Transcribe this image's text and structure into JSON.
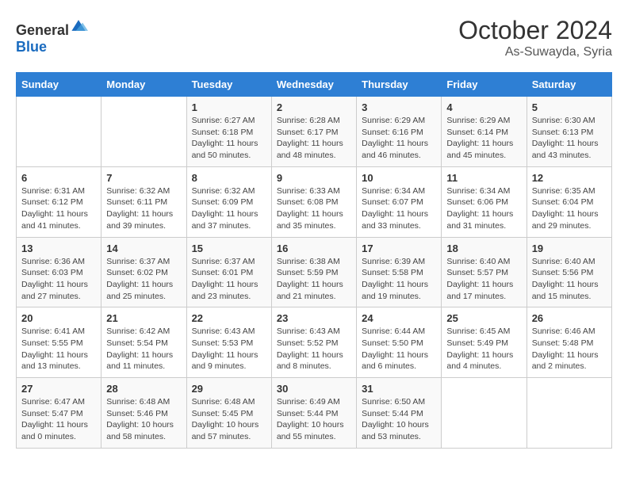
{
  "header": {
    "logo_general": "General",
    "logo_blue": "Blue",
    "month": "October 2024",
    "location": "As-Suwayda, Syria"
  },
  "days_of_week": [
    "Sunday",
    "Monday",
    "Tuesday",
    "Wednesday",
    "Thursday",
    "Friday",
    "Saturday"
  ],
  "weeks": [
    [
      {
        "day": null,
        "info": ""
      },
      {
        "day": null,
        "info": ""
      },
      {
        "day": "1",
        "info": "Sunrise: 6:27 AM\nSunset: 6:18 PM\nDaylight: 11 hours and 50 minutes."
      },
      {
        "day": "2",
        "info": "Sunrise: 6:28 AM\nSunset: 6:17 PM\nDaylight: 11 hours and 48 minutes."
      },
      {
        "day": "3",
        "info": "Sunrise: 6:29 AM\nSunset: 6:16 PM\nDaylight: 11 hours and 46 minutes."
      },
      {
        "day": "4",
        "info": "Sunrise: 6:29 AM\nSunset: 6:14 PM\nDaylight: 11 hours and 45 minutes."
      },
      {
        "day": "5",
        "info": "Sunrise: 6:30 AM\nSunset: 6:13 PM\nDaylight: 11 hours and 43 minutes."
      }
    ],
    [
      {
        "day": "6",
        "info": "Sunrise: 6:31 AM\nSunset: 6:12 PM\nDaylight: 11 hours and 41 minutes."
      },
      {
        "day": "7",
        "info": "Sunrise: 6:32 AM\nSunset: 6:11 PM\nDaylight: 11 hours and 39 minutes."
      },
      {
        "day": "8",
        "info": "Sunrise: 6:32 AM\nSunset: 6:09 PM\nDaylight: 11 hours and 37 minutes."
      },
      {
        "day": "9",
        "info": "Sunrise: 6:33 AM\nSunset: 6:08 PM\nDaylight: 11 hours and 35 minutes."
      },
      {
        "day": "10",
        "info": "Sunrise: 6:34 AM\nSunset: 6:07 PM\nDaylight: 11 hours and 33 minutes."
      },
      {
        "day": "11",
        "info": "Sunrise: 6:34 AM\nSunset: 6:06 PM\nDaylight: 11 hours and 31 minutes."
      },
      {
        "day": "12",
        "info": "Sunrise: 6:35 AM\nSunset: 6:04 PM\nDaylight: 11 hours and 29 minutes."
      }
    ],
    [
      {
        "day": "13",
        "info": "Sunrise: 6:36 AM\nSunset: 6:03 PM\nDaylight: 11 hours and 27 minutes."
      },
      {
        "day": "14",
        "info": "Sunrise: 6:37 AM\nSunset: 6:02 PM\nDaylight: 11 hours and 25 minutes."
      },
      {
        "day": "15",
        "info": "Sunrise: 6:37 AM\nSunset: 6:01 PM\nDaylight: 11 hours and 23 minutes."
      },
      {
        "day": "16",
        "info": "Sunrise: 6:38 AM\nSunset: 5:59 PM\nDaylight: 11 hours and 21 minutes."
      },
      {
        "day": "17",
        "info": "Sunrise: 6:39 AM\nSunset: 5:58 PM\nDaylight: 11 hours and 19 minutes."
      },
      {
        "day": "18",
        "info": "Sunrise: 6:40 AM\nSunset: 5:57 PM\nDaylight: 11 hours and 17 minutes."
      },
      {
        "day": "19",
        "info": "Sunrise: 6:40 AM\nSunset: 5:56 PM\nDaylight: 11 hours and 15 minutes."
      }
    ],
    [
      {
        "day": "20",
        "info": "Sunrise: 6:41 AM\nSunset: 5:55 PM\nDaylight: 11 hours and 13 minutes."
      },
      {
        "day": "21",
        "info": "Sunrise: 6:42 AM\nSunset: 5:54 PM\nDaylight: 11 hours and 11 minutes."
      },
      {
        "day": "22",
        "info": "Sunrise: 6:43 AM\nSunset: 5:53 PM\nDaylight: 11 hours and 9 minutes."
      },
      {
        "day": "23",
        "info": "Sunrise: 6:43 AM\nSunset: 5:52 PM\nDaylight: 11 hours and 8 minutes."
      },
      {
        "day": "24",
        "info": "Sunrise: 6:44 AM\nSunset: 5:50 PM\nDaylight: 11 hours and 6 minutes."
      },
      {
        "day": "25",
        "info": "Sunrise: 6:45 AM\nSunset: 5:49 PM\nDaylight: 11 hours and 4 minutes."
      },
      {
        "day": "26",
        "info": "Sunrise: 6:46 AM\nSunset: 5:48 PM\nDaylight: 11 hours and 2 minutes."
      }
    ],
    [
      {
        "day": "27",
        "info": "Sunrise: 6:47 AM\nSunset: 5:47 PM\nDaylight: 11 hours and 0 minutes."
      },
      {
        "day": "28",
        "info": "Sunrise: 6:48 AM\nSunset: 5:46 PM\nDaylight: 10 hours and 58 minutes."
      },
      {
        "day": "29",
        "info": "Sunrise: 6:48 AM\nSunset: 5:45 PM\nDaylight: 10 hours and 57 minutes."
      },
      {
        "day": "30",
        "info": "Sunrise: 6:49 AM\nSunset: 5:44 PM\nDaylight: 10 hours and 55 minutes."
      },
      {
        "day": "31",
        "info": "Sunrise: 6:50 AM\nSunset: 5:44 PM\nDaylight: 10 hours and 53 minutes."
      },
      {
        "day": null,
        "info": ""
      },
      {
        "day": null,
        "info": ""
      }
    ]
  ]
}
